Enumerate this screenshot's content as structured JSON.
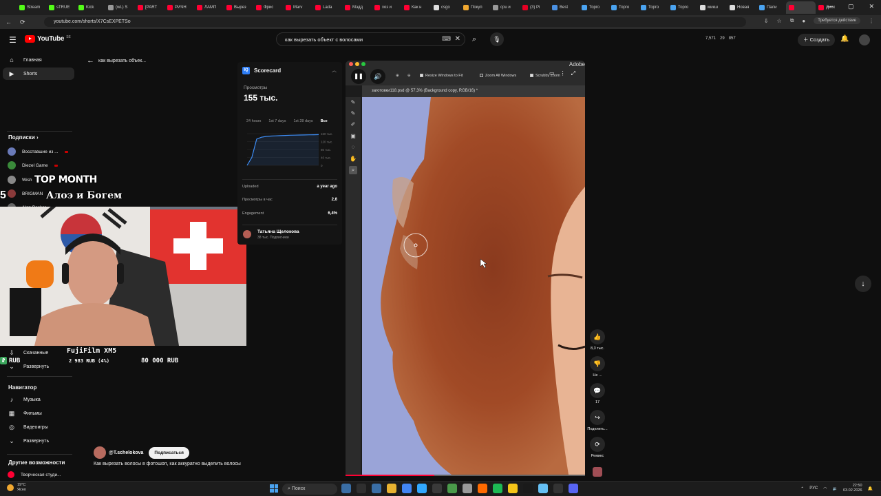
{
  "browser": {
    "tabs": [
      {
        "label": "Stream",
        "color": "#53fc18"
      },
      {
        "label": "sTRUE",
        "color": "#53fc18"
      },
      {
        "label": "Kick",
        "color": "#53fc18"
      },
      {
        "label": "(wL) S",
        "color": "#999999"
      },
      {
        "label": "[PART",
        "color": "#ff0033"
      },
      {
        "label": "РИЧН",
        "color": "#ff0033"
      },
      {
        "label": "ЛАМП",
        "color": "#ff0033"
      },
      {
        "label": "Вырез",
        "color": "#ff0033"
      },
      {
        "label": "Фрис",
        "color": "#ff0033"
      },
      {
        "label": "Marv",
        "color": "#ff0033"
      },
      {
        "label": "Lada",
        "color": "#ff0033"
      },
      {
        "label": "Мэдд",
        "color": "#ff0033"
      },
      {
        "label": "хоз и",
        "color": "#ff0033"
      },
      {
        "label": "Как н",
        "color": "#ff0033"
      },
      {
        "label": "csgo",
        "color": "#dddddd"
      },
      {
        "label": "Покуп",
        "color": "#f0a830"
      },
      {
        "label": "cpu и",
        "color": "#999999"
      },
      {
        "label": "(3) Pi",
        "color": "#e60023"
      },
      {
        "label": "Best",
        "color": "#4a90e2"
      },
      {
        "label": "Торго",
        "color": "#4aa3f0"
      },
      {
        "label": "Торго",
        "color": "#4aa3f0"
      },
      {
        "label": "Торго",
        "color": "#4aa3f0"
      },
      {
        "label": "Торго",
        "color": "#4aa3f0"
      },
      {
        "label": "микш",
        "color": "#dddddd"
      },
      {
        "label": "Новая",
        "color": "#dddddd"
      },
      {
        "label": "Пали",
        "color": "#4aa3f0"
      },
      {
        "label": "",
        "color": "#ff0033",
        "active": true
      },
      {
        "label": "Диск",
        "color": "#ff0033"
      }
    ],
    "window_controls": [
      "—",
      "▢",
      "✕"
    ],
    "url": "youtube.com/shorts/X7CsEXPETSo",
    "status": "Требуется действие"
  },
  "header": {
    "logo": "YouTube",
    "logo_sup": "SE",
    "search_value": "как вырезать объект с волосами",
    "kbd_icon": "⌨",
    "stats": [
      "7,571",
      "29",
      "857"
    ],
    "create_label": "Создать"
  },
  "sidebar": {
    "nav": [
      {
        "label": "Главная",
        "icon": "⌂"
      },
      {
        "label": "Shorts",
        "icon": "▶",
        "active": true
      }
    ],
    "subscriptions_title": "Подписки",
    "subscriptions": [
      {
        "label": "Восставшие из ...",
        "color": "#6a7ab8"
      },
      {
        "label": "Diezel Game",
        "color": "#3a8a3a"
      },
      {
        "label": "Wish",
        "color": "#888888"
      },
      {
        "label": "BRIGMAN",
        "color": "#8a3a3a"
      },
      {
        "label": "Alan Becker",
        "color": "#666666"
      }
    ],
    "downloads_label": "Скачанные",
    "expand_label": "Развернуть",
    "navigator_title": "Навигатор",
    "navigator": [
      {
        "label": "Музыка",
        "icon": "♪"
      },
      {
        "label": "Фильмы",
        "icon": "▦"
      },
      {
        "label": "Видеоигры",
        "icon": "◎"
      },
      {
        "label": "Развернуть",
        "icon": "⌄"
      }
    ],
    "other_title": "Другие возможности",
    "other": [
      {
        "label": "Творческая студи...",
        "color": "#ff0033"
      }
    ]
  },
  "overlay": {
    "top_month": "TOP MONTH",
    "number": "5",
    "names": "Алоэ и Богем",
    "goal_name": "FujiFilm XM5",
    "currency": "RUB",
    "progress": "2 983 RUB (4%)",
    "target": "80 000 RUB"
  },
  "main": {
    "back_title": "как вырезать объек..."
  },
  "scorecard": {
    "title": "Scorecard",
    "logo": "IQ",
    "views_label": "Просмотры",
    "views": "155 тыс.",
    "tabs": [
      "24 hours",
      "1st 7 days",
      "1st 28 days",
      "Все"
    ],
    "rows": [
      {
        "label": "Uploaded",
        "value": "a year ago"
      },
      {
        "label": "Просмотры в час",
        "value": "2,6"
      },
      {
        "label": "Engagement",
        "value": "6,4%"
      }
    ],
    "channel_name": "Татьяна Щелокова",
    "channel_subs": "38 тыс. Подписчики"
  },
  "chart_data": {
    "type": "line",
    "y_ticks": [
      "160 тыс.",
      "120 тыс.",
      "80 тыс.",
      "40 тыс.",
      "0"
    ],
    "ylim": [
      0,
      160000
    ],
    "series": [
      {
        "values": [
          0,
          40000,
          132000,
          142000,
          146000,
          148000,
          149000,
          150000,
          151000,
          152000,
          152500,
          153000,
          153500,
          154000,
          154500,
          155000
        ]
      }
    ],
    "grid": true,
    "color": "#3e8ef7"
  },
  "video": {
    "adobe": "Adobe",
    "resize_label": "Resize Windows to Fit",
    "zoom_all_label": "Zoom All Windows",
    "scrubby_label": "Scrubby Zoom",
    "doc_tab": "заготовки118.psd @ 57,3% (Background copy, RGB/16) *",
    "progress": 0.37
  },
  "actions": [
    {
      "icon": "👍",
      "label": "8,3 тыс."
    },
    {
      "icon": "👎",
      "label": "Не ..."
    },
    {
      "icon": "💬",
      "label": "17"
    },
    {
      "icon": "↪",
      "label": "Поделить..."
    },
    {
      "icon": "⟳",
      "label": "Ремикс"
    }
  ],
  "channel": {
    "name": "@T.schelokova",
    "subscribe_label": "Подписаться",
    "description": "Как вырезать волосы в фотошоп, как аккуратно выделить волосы"
  },
  "taskbar": {
    "temp": "19°C",
    "weather": "Ясно",
    "search_label": "Поиск",
    "apps": [
      "#3a6ea5",
      "#2f2f2f",
      "#3a6ea5",
      "#e8b230",
      "#4285f4",
      "#31a8ff",
      "#3a3a3a",
      "#4a9a4a",
      "#9a9a9a",
      "#ff6a00",
      "#1db954",
      "#f5c518",
      "#1a1a1a",
      "#66c0f4",
      "#333333",
      "#5865f2"
    ],
    "lang": "РУС",
    "time": "22:50",
    "date": "03.02.2026"
  }
}
